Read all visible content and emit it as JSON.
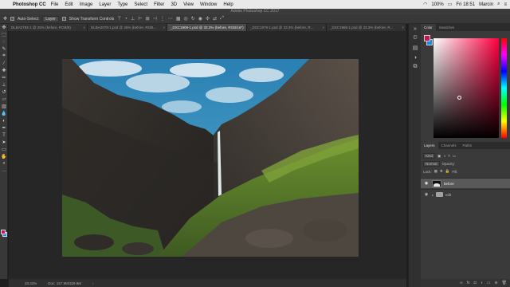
{
  "menubar": {
    "app_name": "Photoshop CC",
    "items": [
      "File",
      "Edit",
      "Image",
      "Layer",
      "Type",
      "Select",
      "Filter",
      "3D",
      "View",
      "Window",
      "Help"
    ],
    "battery": "100%",
    "clock": "Fri 18:51",
    "user": "Marcin"
  },
  "window": {
    "title": "Adobe Photoshop CC 2017"
  },
  "options": {
    "auto_select_label": "Auto-Select:",
    "auto_select_value": "Layer",
    "transform_label": "Show Transform Controls"
  },
  "tabs": [
    {
      "label": "DLBA2792-1 @ 25% (before, RGB/8)"
    },
    {
      "label": "DLBA2078-1.psd @ 25% (before, RGB..."
    },
    {
      "label": "_DSC1909-1.psd @ 33.3% (before, RGB/16*)"
    },
    {
      "label": "_DSC1979-1.psd @ 33.3% (before, R..."
    },
    {
      "label": "_DSC1986-1.psd @ 33.3% (before, R..."
    }
  ],
  "status": {
    "zoom": "33.33%",
    "doc": "Doc: 157.9M/329.9M"
  },
  "colors": {
    "foreground": "#c2185b",
    "background": "#1e88e5"
  },
  "panels": {
    "color_tabs": [
      "Color",
      "Swatches"
    ],
    "layer_tabs": [
      "Layers",
      "Channels",
      "Paths"
    ],
    "kind_label": "Kind",
    "mode_label": "Normal",
    "opacity_label": "Opacity:",
    "lock_label": "Lock:",
    "fill_label": "Fill:",
    "layers": [
      {
        "name": "before",
        "type": "image"
      },
      {
        "name": "edit",
        "type": "group"
      }
    ]
  }
}
